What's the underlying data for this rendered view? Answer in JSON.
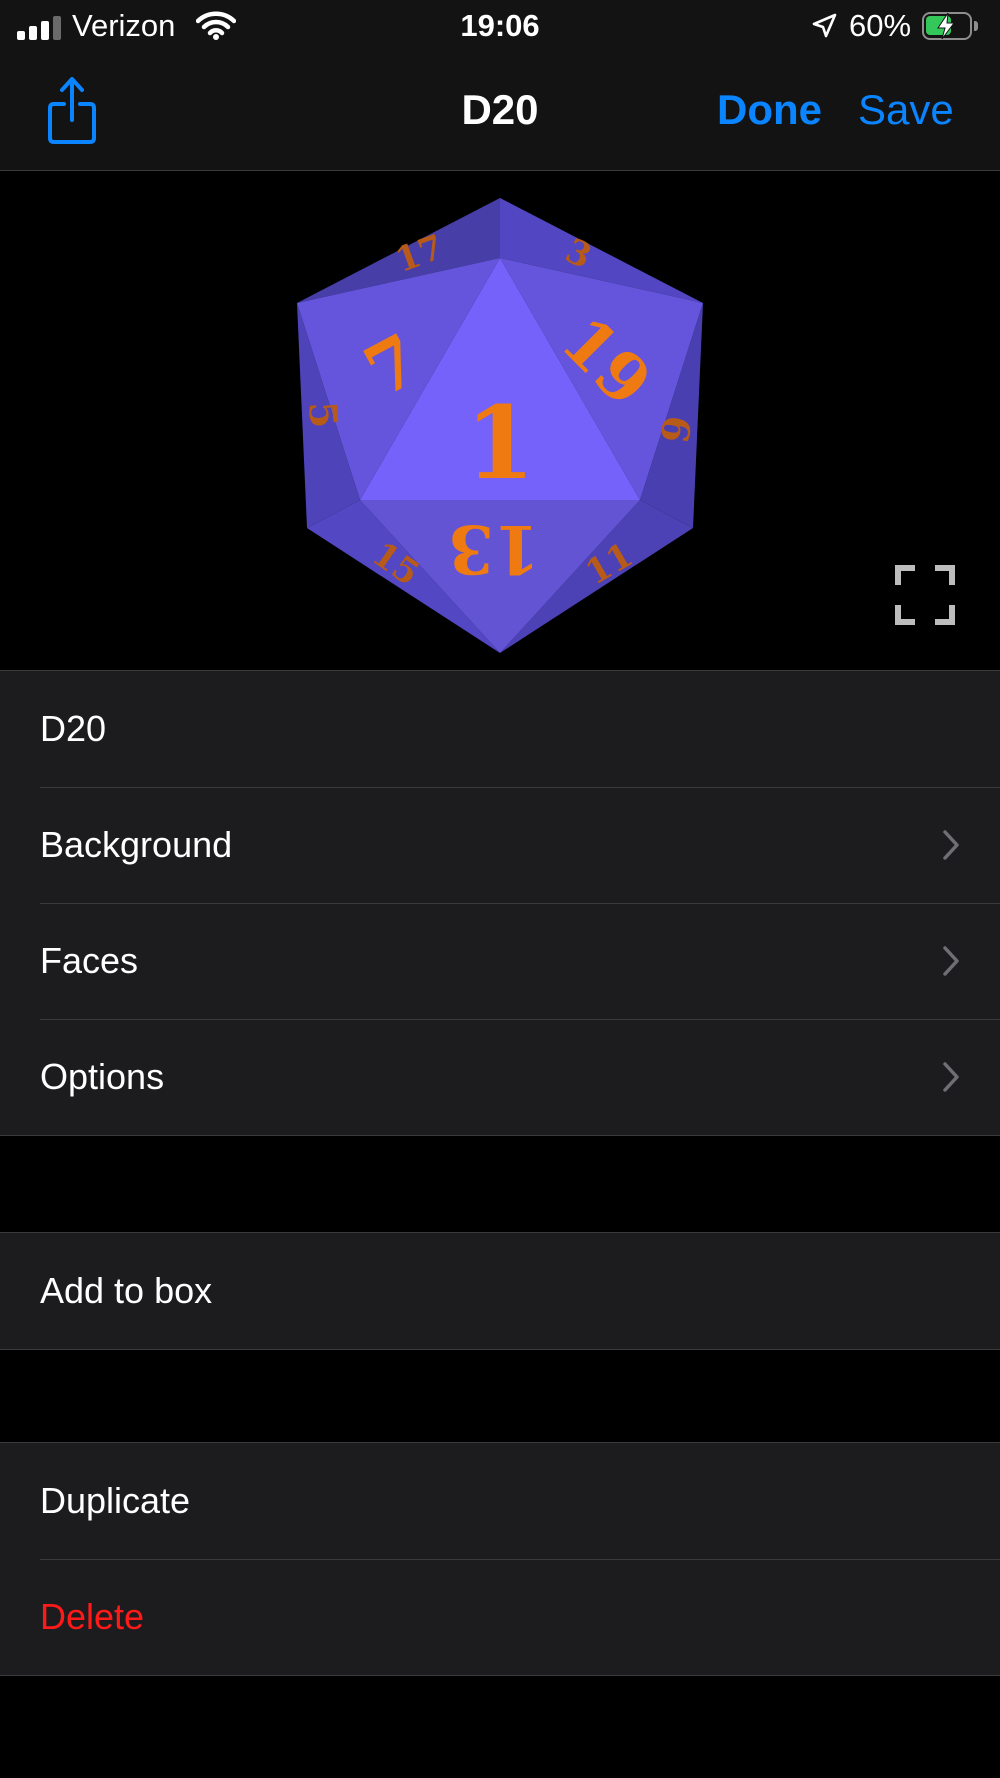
{
  "status_bar": {
    "carrier": "Verizon",
    "time": "19:06",
    "battery_percent": "60%",
    "battery_level": 0.6,
    "signal_bars_filled": 3,
    "signal_bars_total": 4
  },
  "nav": {
    "title": "D20",
    "done_label": "Done",
    "save_label": "Save",
    "share_icon": "share-icon"
  },
  "preview": {
    "die_type": "D20",
    "die_color": "#6f5ff0",
    "number_color": "#ef7a12",
    "visible_numbers": {
      "front": "1",
      "upper_left": "7",
      "upper_right": "19",
      "lower": "13",
      "top_left": "17",
      "top_right": "3",
      "left": "5",
      "right": "9",
      "lower_left": "15",
      "lower_right": "11"
    },
    "expand_icon": "expand-icon"
  },
  "settings": {
    "name_row": "D20",
    "items": [
      {
        "label": "Background"
      },
      {
        "label": "Faces"
      },
      {
        "label": "Options"
      }
    ]
  },
  "actions": {
    "add_to_box": "Add to box",
    "duplicate": "Duplicate",
    "delete": "Delete"
  },
  "colors": {
    "accent": "#0a84ff",
    "destructive": "#ff1a1a",
    "cell_background": "#1c1c1e",
    "background": "#000000"
  }
}
